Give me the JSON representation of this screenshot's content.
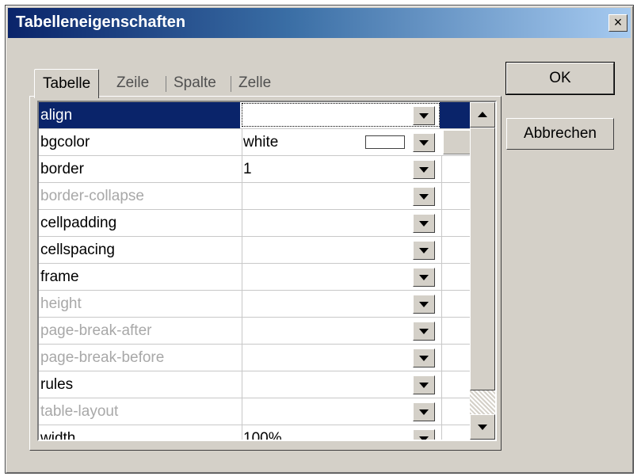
{
  "window": {
    "title": "Tabelleneigenschaften",
    "close_symbol": "×"
  },
  "tabs": [
    {
      "label": "Tabelle",
      "active": true
    },
    {
      "label": "Zeile",
      "active": false
    },
    {
      "label": "Spalte",
      "active": false
    },
    {
      "label": "Zelle",
      "active": false
    }
  ],
  "properties": [
    {
      "name": "align",
      "value": "",
      "enabled": true,
      "selected": true
    },
    {
      "name": "bgcolor",
      "value": "white",
      "enabled": true,
      "swatch_color": "#ffffff"
    },
    {
      "name": "border",
      "value": "1",
      "enabled": true
    },
    {
      "name": "border-collapse",
      "value": "",
      "enabled": false
    },
    {
      "name": "cellpadding",
      "value": "",
      "enabled": true
    },
    {
      "name": "cellspacing",
      "value": "",
      "enabled": true
    },
    {
      "name": "frame",
      "value": "",
      "enabled": true
    },
    {
      "name": "height",
      "value": "",
      "enabled": false
    },
    {
      "name": "page-break-after",
      "value": "",
      "enabled": false
    },
    {
      "name": "page-break-before",
      "value": "",
      "enabled": false
    },
    {
      "name": "rules",
      "value": "",
      "enabled": true
    },
    {
      "name": "table-layout",
      "value": "",
      "enabled": false
    },
    {
      "name": "width",
      "value": "100%",
      "enabled": true
    }
  ],
  "buttons": {
    "ok": "OK",
    "cancel": "Abbrechen"
  },
  "colors": {
    "selection": "#0a246a",
    "disabled_text": "#a8a8a8",
    "face": "#d4d0c8"
  }
}
